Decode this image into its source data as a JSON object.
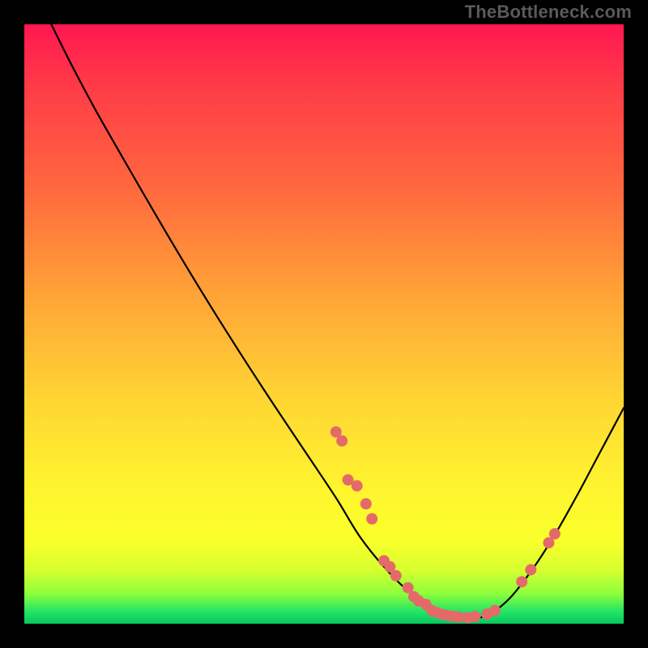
{
  "watermark": "TheBottleneck.com",
  "colors": {
    "page_bg": "#000000",
    "gradient_top": "#ff1751",
    "gradient_mid": "#ffd433",
    "gradient_bottom": "#06c85e",
    "curve": "#000000",
    "dots": "#e46a6a"
  },
  "chart_data": {
    "type": "line",
    "title": "",
    "xlabel": "",
    "ylabel": "",
    "xlim": [
      0,
      100
    ],
    "ylim": [
      0,
      100
    ],
    "grid": false,
    "legend": false,
    "curve_points_pct": [
      [
        4.5,
        100.0
      ],
      [
        8.0,
        93.0
      ],
      [
        12.0,
        85.5
      ],
      [
        18.0,
        75.0
      ],
      [
        25.0,
        63.0
      ],
      [
        32.0,
        51.5
      ],
      [
        40.0,
        39.0
      ],
      [
        47.0,
        28.5
      ],
      [
        52.0,
        21.0
      ],
      [
        56.0,
        14.5
      ],
      [
        60.0,
        9.5
      ],
      [
        64.0,
        5.5
      ],
      [
        68.0,
        2.8
      ],
      [
        72.0,
        1.2
      ],
      [
        76.0,
        1.0
      ],
      [
        80.0,
        3.3
      ],
      [
        84.0,
        8.0
      ],
      [
        88.0,
        14.0
      ],
      [
        92.0,
        21.0
      ],
      [
        96.0,
        28.5
      ],
      [
        100.0,
        36.0
      ]
    ],
    "dots_pct": [
      [
        52.0,
        32.0
      ],
      [
        53.0,
        30.5
      ],
      [
        54.0,
        24.0
      ],
      [
        55.5,
        23.0
      ],
      [
        57.0,
        20.0
      ],
      [
        58.0,
        17.5
      ],
      [
        60.0,
        10.5
      ],
      [
        61.0,
        9.5
      ],
      [
        62.0,
        8.0
      ],
      [
        64.0,
        6.0
      ],
      [
        65.0,
        4.5
      ],
      [
        65.8,
        3.8
      ],
      [
        67.0,
        3.2
      ],
      [
        68.0,
        2.2
      ],
      [
        69.0,
        1.8
      ],
      [
        70.0,
        1.5
      ],
      [
        71.0,
        1.3
      ],
      [
        71.8,
        1.2
      ],
      [
        72.5,
        1.1
      ],
      [
        74.0,
        1.0
      ],
      [
        75.2,
        1.2
      ],
      [
        77.2,
        1.6
      ],
      [
        78.5,
        2.2
      ],
      [
        83.0,
        7.0
      ],
      [
        84.5,
        9.0
      ],
      [
        87.5,
        13.5
      ],
      [
        88.5,
        15.0
      ]
    ],
    "annotations": []
  }
}
